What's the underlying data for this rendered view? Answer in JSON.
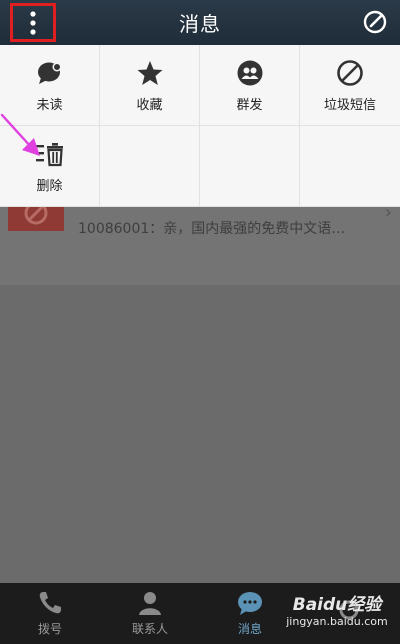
{
  "header": {
    "title": "消息"
  },
  "popup": {
    "items": [
      {
        "label": "未读"
      },
      {
        "label": "收藏"
      },
      {
        "label": "群发"
      },
      {
        "label": "垃圾短信"
      },
      {
        "label": "删除"
      }
    ]
  },
  "background_list": {
    "message_preview": "10086001：亲，国内最强的免费中文语…"
  },
  "bottom_nav": {
    "items": [
      {
        "label": "拨号"
      },
      {
        "label": "联系人"
      },
      {
        "label": "消息"
      },
      {
        "label": ""
      }
    ],
    "active_index": 2
  },
  "watermark": {
    "brand": "Baidu经验",
    "url": "jingyan.baidu.com"
  },
  "colors": {
    "accent": "#6fa7c9",
    "highlight": "#e02020",
    "arrow": "#e040e0"
  }
}
